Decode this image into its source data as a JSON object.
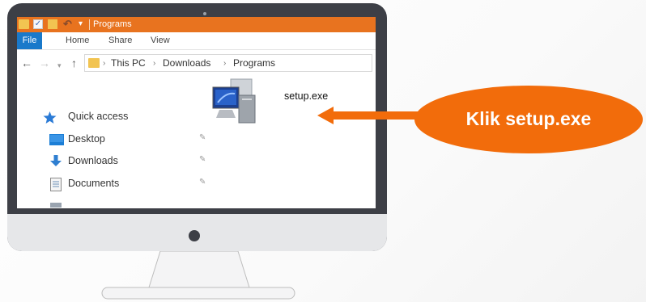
{
  "window": {
    "title": "Programs"
  },
  "ribbon": {
    "tabs": [
      "File",
      "Home",
      "Share",
      "View"
    ]
  },
  "address": {
    "crumbs": [
      "This PC",
      "Downloads",
      "Programs"
    ],
    "separator": "›"
  },
  "sidebar": {
    "items": [
      {
        "label": "Quick access",
        "icon": "star-icon"
      },
      {
        "label": "Desktop",
        "icon": "desktop-icon",
        "pinned": true
      },
      {
        "label": "Downloads",
        "icon": "download-arrow-icon",
        "pinned": true
      },
      {
        "label": "Documents",
        "icon": "document-icon",
        "pinned": true
      }
    ]
  },
  "file": {
    "name": "setup.exe",
    "icon": "computer-setup-icon"
  },
  "callout": {
    "text": "Klik setup.exe",
    "color": "#f26c0b"
  },
  "colors": {
    "titlebar": "#e8731f",
    "file_tab": "#1979ca",
    "monitor": "#3d3f46"
  }
}
